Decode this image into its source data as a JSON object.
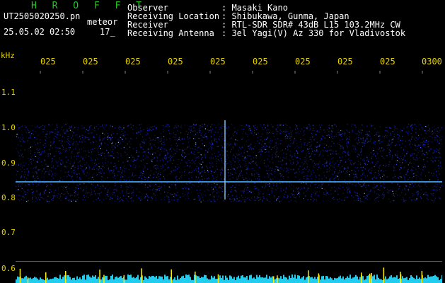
{
  "header": {
    "brand": "H R O F F T",
    "filename": "UT2505020250.pn",
    "type": "meteor",
    "datetime": "25.05.02 02:50",
    "count": "17_",
    "fields": [
      {
        "label": "Observer",
        "value": ": Masaki Kano"
      },
      {
        "label": "Receiving Location",
        "value": ": Shibukawa, Gunma, Japan"
      },
      {
        "label": "Receiver",
        "value": ": RTL-SDR SDR# 43dB L15 103.2MHz CW"
      },
      {
        "label": "Receiving Antenna",
        "value": ": 3el Yagi(V) Az 330 for Vladivostok"
      }
    ]
  },
  "y_axis": {
    "unit": "kHz",
    "labels": [
      "1.1",
      "1.0",
      "0.9",
      "0.8",
      "0.7",
      "0.6"
    ]
  },
  "x_axis": {
    "labels": [
      "025",
      "025",
      "025",
      "025",
      "025",
      "025",
      "025",
      "025",
      "025",
      "0300"
    ]
  },
  "colors": {
    "brand": "#22cc22",
    "axis_text": "#e6d200",
    "signal": "#2233ff",
    "carrier": "#44aaff",
    "noise_floor": "#22ccee",
    "spike": "#ffee00"
  }
}
